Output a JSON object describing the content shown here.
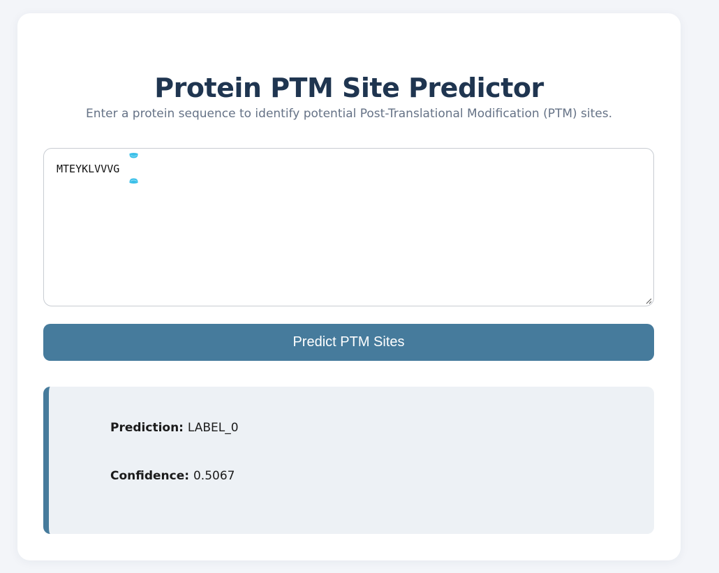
{
  "header": {
    "title": "Protein PTM Site Predictor",
    "subtitle": "Enter a protein sequence to identify potential Post-Translational Modification (PTM) sites."
  },
  "sequence_input": {
    "value": "MTEYKLVVVG",
    "placeholder": ""
  },
  "predict_button": {
    "label": "Predict PTM Sites"
  },
  "result": {
    "prediction_label": "Prediction:",
    "prediction_value": "LABEL_0",
    "confidence_label": "Confidence:",
    "confidence_value": "0.5067"
  },
  "colors": {
    "page_background": "#f3f5f9",
    "card_background": "#ffffff",
    "title": "#1f3550",
    "subtitle": "#657286",
    "accent": "#467b9c",
    "result_background": "#edf1f5",
    "selection_handle": "#3bbfe8"
  },
  "icons": {
    "selection_handles": "text-selection-handle-icon",
    "resize_grip": "resize-grip-icon"
  }
}
